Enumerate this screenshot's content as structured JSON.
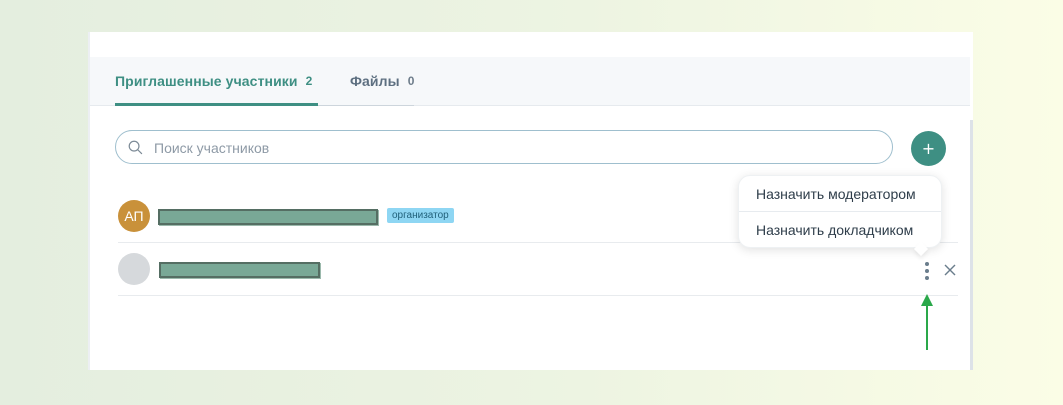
{
  "tabs": [
    {
      "label": "Приглашенные участники",
      "count": "2",
      "active": true
    },
    {
      "label": "Файлы",
      "count": "0",
      "active": false
    }
  ],
  "search": {
    "placeholder": "Поиск участников",
    "icon": "search-icon"
  },
  "add_button": {
    "label": "+"
  },
  "participants": [
    {
      "initials": "АП",
      "avatar_color": "#c9913a",
      "role_badge": "организатор"
    },
    {
      "initials": "",
      "avatar_color": "#d6d9dc",
      "role_badge": ""
    }
  ],
  "context_menu": {
    "items": [
      {
        "label": "Назначить модератором"
      },
      {
        "label": "Назначить докладчиком"
      }
    ]
  },
  "colors": {
    "accent": "#3e8f83",
    "arrow": "#2aa84a",
    "badge_bg": "#8ed6f3"
  }
}
